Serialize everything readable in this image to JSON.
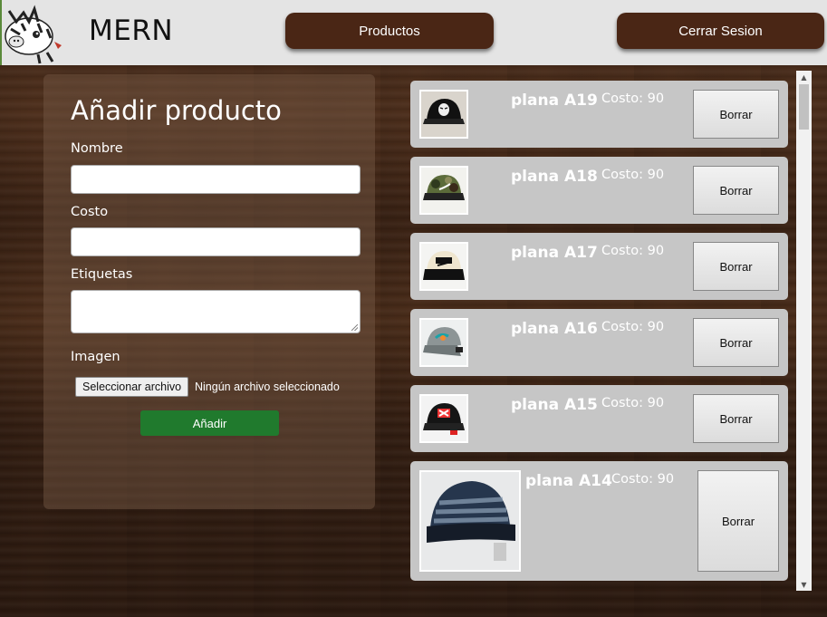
{
  "navbar": {
    "brand": "MERN",
    "products_label": "Productos",
    "logout_label": "Cerrar Sesion"
  },
  "form": {
    "title": "Añadir producto",
    "name_label": "Nombre",
    "name_value": "",
    "cost_label": "Costo",
    "cost_value": "",
    "tags_label": "Etiquetas",
    "tags_value": "",
    "image_label": "Imagen",
    "file_button_label": "Seleccionar archivo",
    "file_status": "Ningún archivo seleccionado",
    "submit_label": "Añadir"
  },
  "products": [
    {
      "name": "plana A19",
      "cost": "Costo: 90",
      "delete_label": "Borrar",
      "thumb": "cap-black-mask-icon"
    },
    {
      "name": "plana A18",
      "cost": "Costo: 90",
      "delete_label": "Borrar",
      "thumb": "cap-camo-icon"
    },
    {
      "name": "plana A17",
      "cost": "Costo: 90",
      "delete_label": "Borrar",
      "thumb": "cap-cream-black-icon"
    },
    {
      "name": "plana A16",
      "cost": "Costo: 90",
      "delete_label": "Borrar",
      "thumb": "cap-grey-icon"
    },
    {
      "name": "plana A15",
      "cost": "Costo: 90",
      "delete_label": "Borrar",
      "thumb": "cap-black-red-icon"
    },
    {
      "name": "plana A14",
      "cost": "Costo: 90",
      "delete_label": "Borrar",
      "thumb": "cap-navy-print-icon"
    }
  ],
  "colors": {
    "header_bg": "#e4e4e4",
    "nav_button": "#4a2615",
    "add_button": "#207a2d",
    "card_bg": "#c6c6c6"
  }
}
